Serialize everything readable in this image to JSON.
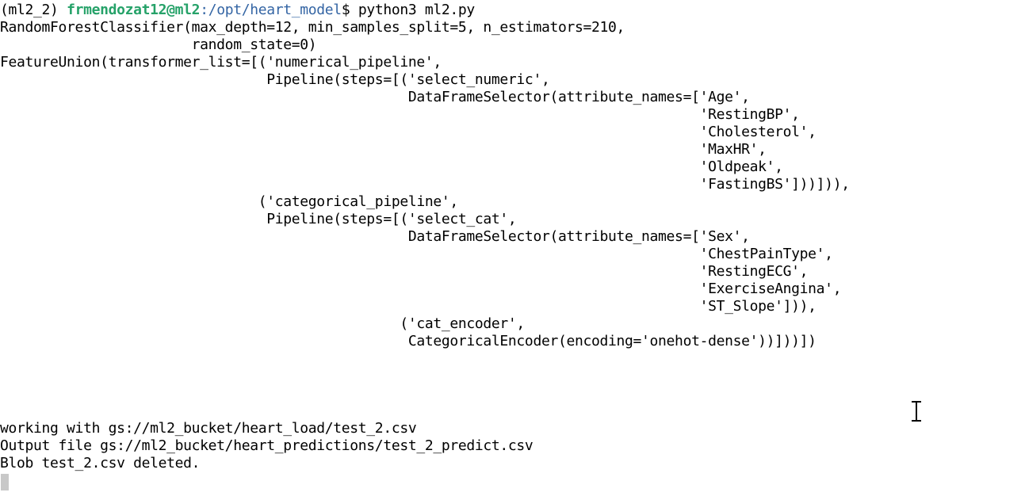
{
  "prompt": {
    "env": "(ml2_2) ",
    "user_host": "frmendozat12@ml2",
    "path": ":/opt/heart_model",
    "symbol": "$ ",
    "command": "python3 ml2.py"
  },
  "output": {
    "model_lines": [
      "RandomForestClassifier(max_depth=12, min_samples_split=5, n_estimators=210,",
      "                       random_state=0)",
      "FeatureUnion(transformer_list=[('numerical_pipeline',",
      "                                Pipeline(steps=[('select_numeric',",
      "                                                 DataFrameSelector(attribute_names=['Age',",
      "                                                                                    'RestingBP',",
      "                                                                                    'Cholesterol',",
      "                                                                                    'MaxHR',",
      "                                                                                    'Oldpeak',",
      "                                                                                    'FastingBS']))])),",
      "                               ('categorical_pipeline',",
      "                                Pipeline(steps=[('select_cat',",
      "                                                 DataFrameSelector(attribute_names=['Sex',",
      "                                                                                    'ChestPainType',",
      "                                                                                    'RestingECG',",
      "                                                                                    'ExerciseAngina',",
      "                                                                                    'ST_Slope'])),",
      "                                                ('cat_encoder',",
      "                                                 CategoricalEncoder(encoding='onehot-dense'))]))])"
    ],
    "status_lines": [
      "working with gs://ml2_bucket/heart_load/test_2.csv",
      "Output file gs://ml2_bucket/heart_predictions/test_2_predict.csv",
      "Blob test_2.csv deleted."
    ]
  },
  "icons": {
    "cursor": "block-cursor-icon",
    "mouse_pointer": "text-ibeam-icon"
  },
  "colors": {
    "background": "#ffffff",
    "text": "#000000",
    "user_host": "#26a269",
    "path": "#3465a4",
    "cursor": "#c8c8c8"
  }
}
